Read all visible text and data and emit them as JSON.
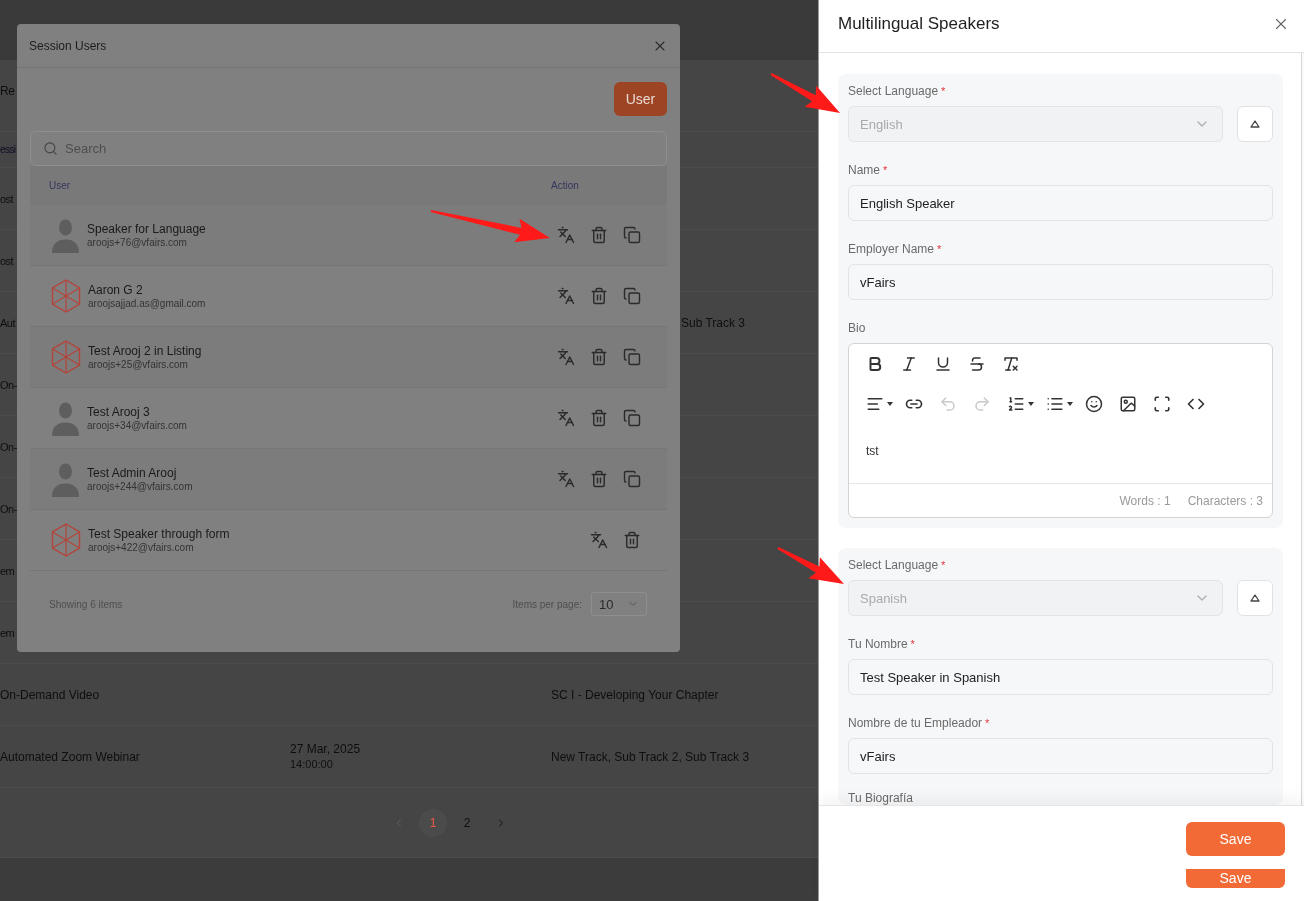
{
  "background_page": {
    "tab_label": "Re",
    "header_fragment": "essi",
    "rows": [
      {
        "kind": "covered",
        "column_1": "ost"
      },
      {
        "kind": "covered",
        "column_1": "ost"
      },
      {
        "kind": "covered",
        "column_1": "Aut",
        "column_3": "Sub Track 3"
      },
      {
        "kind": "covered",
        "column_1": "On-"
      },
      {
        "kind": "covered",
        "column_1": "On-"
      },
      {
        "kind": "covered",
        "column_1": "On-"
      },
      {
        "kind": "covered",
        "column_1": "em"
      },
      {
        "kind": "covered",
        "column_1": "em"
      },
      {
        "kind": "full",
        "column_1": "On-Demand Video",
        "column_3": "SC I - Developing Your Chapter"
      },
      {
        "kind": "full",
        "column_1": "Automated Zoom Webinar",
        "column_2": {
          "date": "27 Mar, 2025",
          "time": "14:00:00"
        },
        "column_3": "New Track, Sub Track 2, Sub Track 3"
      }
    ],
    "pagination": {
      "previous_disabled": true,
      "next_disabled": false,
      "pages": [
        {
          "label": "1",
          "selected": true
        },
        {
          "label": "2",
          "selected": false
        }
      ]
    }
  },
  "session_users_modal": {
    "title": "Session Users",
    "add_button": "User",
    "search": {
      "placeholder": "Search"
    },
    "columns": [
      "User",
      "Action"
    ],
    "users": [
      {
        "kind": "silhouette",
        "name": "Speaker for Language",
        "email": "aroojs+76@vfairs.com",
        "actions": [
          {
            "kind": "translate"
          },
          {
            "kind": "delete"
          },
          {
            "kind": "copy"
          }
        ]
      },
      {
        "kind": "logo",
        "name": "Aaron G 2",
        "email": "aroojsajjad.as@gmail.com",
        "actions": [
          {
            "kind": "translate"
          },
          {
            "kind": "delete"
          },
          {
            "kind": "copy"
          }
        ]
      },
      {
        "kind": "logo",
        "name": "Test Arooj 2 in Listing",
        "email": "aroojs+25@vfairs.com",
        "actions": [
          {
            "kind": "translate"
          },
          {
            "kind": "delete"
          },
          {
            "kind": "copy"
          }
        ]
      },
      {
        "kind": "silhouette",
        "name": "Test Arooj 3",
        "email": "aroojs+34@vfairs.com",
        "actions": [
          {
            "kind": "translate"
          },
          {
            "kind": "delete"
          },
          {
            "kind": "copy"
          }
        ]
      },
      {
        "kind": "silhouette",
        "name": "Test Admin Arooj",
        "email": "aroojs+244@vfairs.com",
        "actions": [
          {
            "kind": "translate"
          },
          {
            "kind": "delete"
          },
          {
            "kind": "copy"
          }
        ]
      },
      {
        "kind": "logo",
        "name": "Test Speaker through form",
        "email": "aroojs+422@vfairs.com",
        "actions": [
          {
            "kind": "translate"
          },
          {
            "kind": "delete"
          }
        ]
      }
    ],
    "footer": {
      "summary": "Showing 6 items",
      "per_page_label": "Items per page:",
      "per_page_value": "10"
    }
  },
  "drawer": {
    "title": "Multilingual Speakers",
    "sections": [
      {
        "language": {
          "label": "Select Language",
          "required_mark": "*",
          "value": "English",
          "disabled": true
        },
        "expanded": true,
        "fields": [
          {
            "kind": "input",
            "label": "Name",
            "required_mark": "*",
            "value": "English Speaker"
          },
          {
            "kind": "input",
            "label": "Employer Name",
            "required_mark": "*",
            "value": "vFairs"
          },
          {
            "kind": "editor",
            "label": "Bio",
            "content": "tst",
            "toolbar_rows": [
              [
                {
                  "kind": "bold",
                  "dropdown": false,
                  "disabled": false
                },
                {
                  "kind": "italic",
                  "dropdown": false,
                  "disabled": false
                },
                {
                  "kind": "underline",
                  "dropdown": false,
                  "disabled": false
                },
                {
                  "kind": "strikethrough",
                  "dropdown": false,
                  "disabled": false
                },
                {
                  "kind": "clear_format",
                  "dropdown": false,
                  "disabled": false
                }
              ],
              [
                {
                  "kind": "align",
                  "dropdown": true,
                  "disabled": false
                },
                {
                  "kind": "link",
                  "dropdown": false,
                  "disabled": false
                },
                {
                  "kind": "undo",
                  "dropdown": false,
                  "disabled": true
                },
                {
                  "kind": "redo",
                  "dropdown": false,
                  "disabled": true
                },
                {
                  "kind": "ordered_list",
                  "dropdown": true,
                  "disabled": false
                },
                {
                  "kind": "bullet_list",
                  "dropdown": true,
                  "disabled": false
                },
                {
                  "kind": "emoji",
                  "dropdown": false,
                  "disabled": false
                },
                {
                  "kind": "image",
                  "dropdown": false,
                  "disabled": false
                },
                {
                  "kind": "fullscreen",
                  "dropdown": false,
                  "disabled": false
                },
                {
                  "kind": "code",
                  "dropdown": false,
                  "disabled": false
                }
              ]
            ],
            "word_count": "Words : 1",
            "character_count": "Characters : 3"
          }
        ]
      },
      {
        "language": {
          "label": "Select Language",
          "required_mark": "*",
          "value": "Spanish",
          "disabled": true
        },
        "expanded": true,
        "fields": [
          {
            "kind": "input",
            "label": "Tu Nombre",
            "required_mark": "*",
            "value": "Test Speaker in Spanish"
          },
          {
            "kind": "input",
            "label": "Nombre de tu Empleador",
            "required_mark": "*",
            "value": "vFairs"
          },
          {
            "kind": "label",
            "label": "Tu Biografía"
          }
        ]
      }
    ],
    "footer_buttons": [
      {
        "label": "Save",
        "kind": "primary"
      },
      {
        "label": "Save",
        "kind": "clipped"
      }
    ]
  }
}
